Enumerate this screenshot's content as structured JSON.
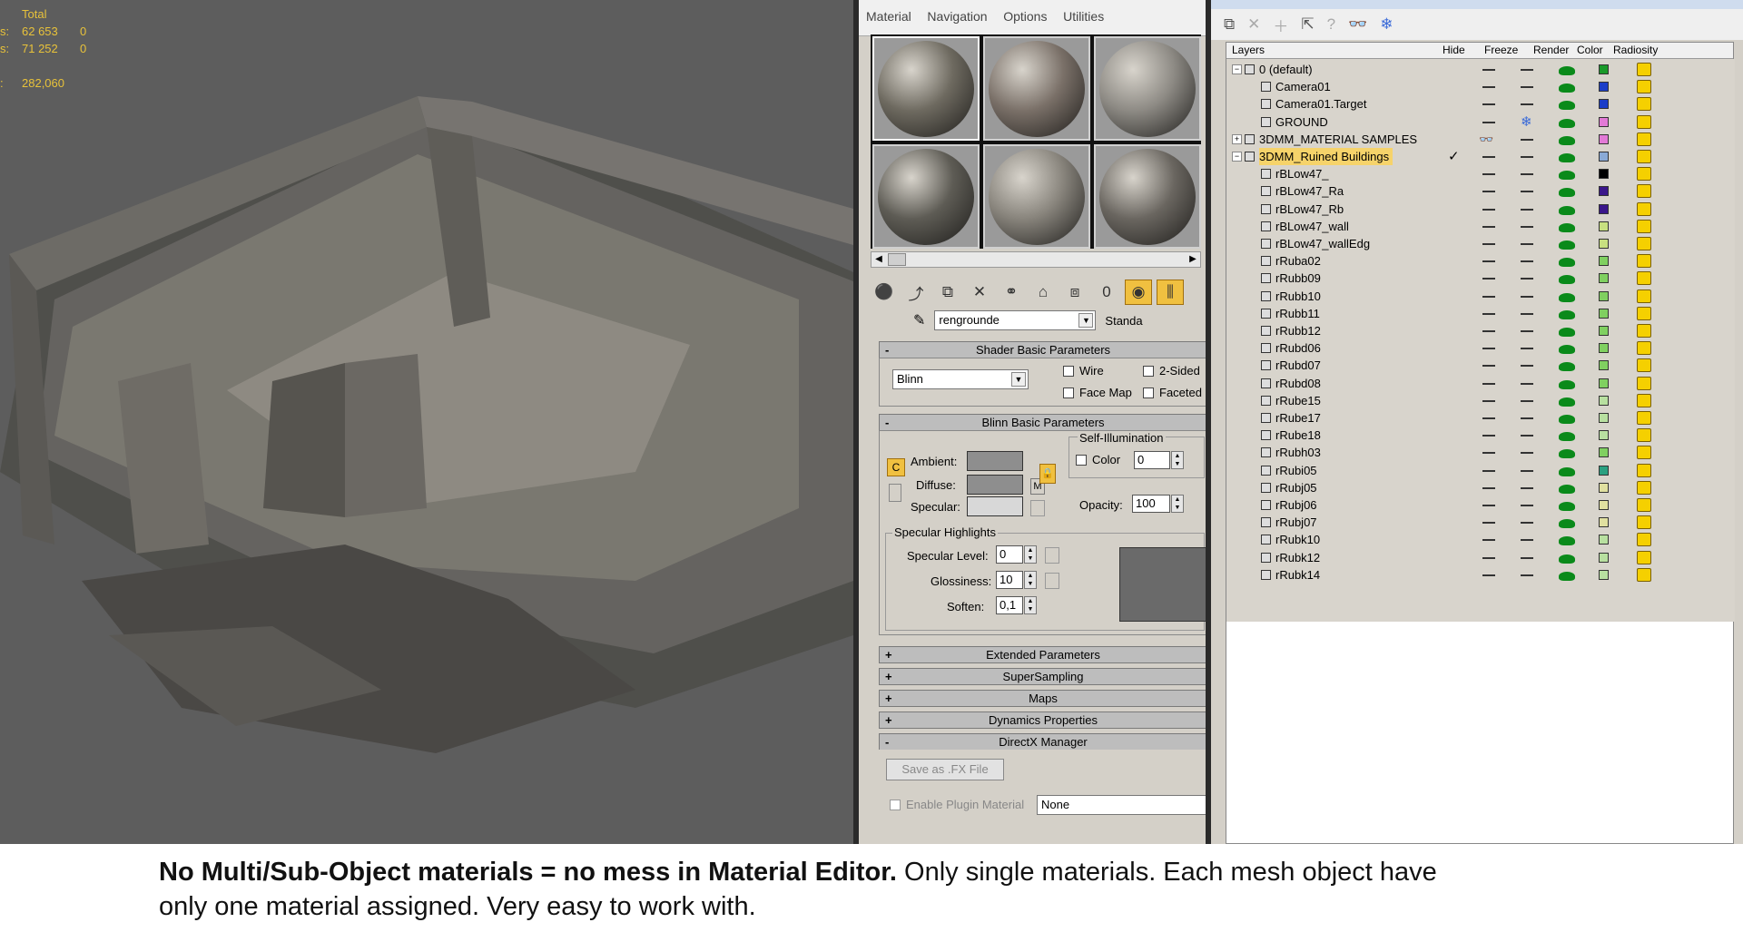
{
  "viewport": {
    "stats": {
      "header": "Total",
      "rows": [
        {
          "label": "s:",
          "value": "62 653",
          "sel": "0"
        },
        {
          "label": "s:",
          "value": "71 252",
          "sel": "0"
        },
        {
          "label": ":",
          "value": "282,060",
          "sel": ""
        }
      ]
    }
  },
  "material_editor": {
    "menu": [
      "Material",
      "Navigation",
      "Options",
      "Utilities"
    ],
    "spheres": [
      {
        "color": "#6e6a60"
      },
      {
        "color": "#7a7068"
      },
      {
        "color": "#8d8a84"
      },
      {
        "color": "#5e5c55"
      },
      {
        "color": "#88847c"
      },
      {
        "color": "#6a6660"
      }
    ],
    "material_name": "rengrounde",
    "material_type": "Standa",
    "rollouts": {
      "shader": "Shader Basic Parameters",
      "blinn": "Blinn Basic Parameters",
      "extended": "Extended Parameters",
      "supersampling": "SuperSampling",
      "maps": "Maps",
      "dynamics": "Dynamics Properties",
      "directx": "DirectX Manager"
    },
    "shader_type": "Blinn",
    "checks": {
      "wire": "Wire",
      "two_sided": "2-Sided",
      "face_map": "Face Map",
      "faceted": "Faceted"
    },
    "ambient": "Ambient:",
    "diffuse": "Diffuse:",
    "specular": "Specular:",
    "map_button": "M",
    "self_illum": "Self-Illumination",
    "self_illum_color": "Color",
    "self_illum_value": "0",
    "opacity_label": "Opacity:",
    "opacity_value": "100",
    "spec_highlights": "Specular Highlights",
    "spec_level_label": "Specular Level:",
    "spec_level": "0",
    "glossiness_label": "Glossiness:",
    "glossiness": "10",
    "soften_label": "Soften:",
    "soften": "0,1",
    "save_fx": "Save as .FX File",
    "enable_plugin": "Enable Plugin Material",
    "plugin_value": "None"
  },
  "layer_manager": {
    "columns": [
      "Layers",
      "Hide",
      "Freeze",
      "Render",
      "Color",
      "Radiosity"
    ],
    "rows": [
      {
        "name": "0 (default)",
        "level": 0,
        "layer": true,
        "expander": "−",
        "color": "#1a9a2a",
        "hide": "—",
        "freeze": "—",
        "current": false
      },
      {
        "name": "Camera01",
        "level": 1,
        "layer": false,
        "color": "#1c3ec8",
        "hide": "—",
        "freeze": "—",
        "current": false
      },
      {
        "name": "Camera01.Target",
        "level": 1,
        "layer": false,
        "color": "#1c3ec8",
        "hide": "—",
        "freeze": "—",
        "current": false
      },
      {
        "name": "GROUND",
        "level": 1,
        "layer": false,
        "color": "#e27ad6",
        "hide": "—",
        "freeze": "❄",
        "current": false
      },
      {
        "name": "3DMM_MATERIAL SAMPLES",
        "level": 0,
        "layer": true,
        "expander": "+",
        "color": "#e27ad6",
        "hide": "👓",
        "freeze": "—",
        "current": false
      },
      {
        "name": "3DMM_Ruined Buildings",
        "level": 0,
        "layer": true,
        "expander": "−",
        "color": "#8aaad6",
        "hide": "—",
        "freeze": "—",
        "current": true,
        "check": "✓"
      },
      {
        "name": "rBLow47_",
        "level": 1,
        "layer": false,
        "color": "#000000",
        "hide": "—",
        "freeze": "—",
        "current": false
      },
      {
        "name": "rBLow47_Ra",
        "level": 1,
        "layer": false,
        "color": "#3a168a",
        "hide": "—",
        "freeze": "—",
        "current": false
      },
      {
        "name": "rBLow47_Rb",
        "level": 1,
        "layer": false,
        "color": "#3a168a",
        "hide": "—",
        "freeze": "—",
        "current": false
      },
      {
        "name": "rBLow47_wall",
        "level": 1,
        "layer": false,
        "color": "#c8e080",
        "hide": "—",
        "freeze": "—",
        "current": false
      },
      {
        "name": "rBLow47_wallEdg",
        "level": 1,
        "layer": false,
        "color": "#c8e080",
        "hide": "—",
        "freeze": "—",
        "current": false
      },
      {
        "name": "rRuba02",
        "level": 1,
        "layer": false,
        "color": "#80d060",
        "hide": "—",
        "freeze": "—",
        "current": false
      },
      {
        "name": "rRubb09",
        "level": 1,
        "layer": false,
        "color": "#80d060",
        "hide": "—",
        "freeze": "—",
        "current": false
      },
      {
        "name": "rRubb10",
        "level": 1,
        "layer": false,
        "color": "#80d060",
        "hide": "—",
        "freeze": "—",
        "current": false
      },
      {
        "name": "rRubb11",
        "level": 1,
        "layer": false,
        "color": "#80d060",
        "hide": "—",
        "freeze": "—",
        "current": false
      },
      {
        "name": "rRubb12",
        "level": 1,
        "layer": false,
        "color": "#80d060",
        "hide": "—",
        "freeze": "—",
        "current": false
      },
      {
        "name": "rRubd06",
        "level": 1,
        "layer": false,
        "color": "#80d060",
        "hide": "—",
        "freeze": "—",
        "current": false
      },
      {
        "name": "rRubd07",
        "level": 1,
        "layer": false,
        "color": "#80d060",
        "hide": "—",
        "freeze": "—",
        "current": false
      },
      {
        "name": "rRubd08",
        "level": 1,
        "layer": false,
        "color": "#80d060",
        "hide": "—",
        "freeze": "—",
        "current": false
      },
      {
        "name": "rRube15",
        "level": 1,
        "layer": false,
        "color": "#b8e0a0",
        "hide": "—",
        "freeze": "—",
        "current": false
      },
      {
        "name": "rRube17",
        "level": 1,
        "layer": false,
        "color": "#b8e0a0",
        "hide": "—",
        "freeze": "—",
        "current": false
      },
      {
        "name": "rRube18",
        "level": 1,
        "layer": false,
        "color": "#b8e0a0",
        "hide": "—",
        "freeze": "—",
        "current": false
      },
      {
        "name": "rRubh03",
        "level": 1,
        "layer": false,
        "color": "#80d060",
        "hide": "—",
        "freeze": "—",
        "current": false
      },
      {
        "name": "rRubi05",
        "level": 1,
        "layer": false,
        "color": "#2aa080",
        "hide": "—",
        "freeze": "—",
        "current": false
      },
      {
        "name": "rRubj05",
        "level": 1,
        "layer": false,
        "color": "#e0e0a0",
        "hide": "—",
        "freeze": "—",
        "current": false
      },
      {
        "name": "rRubj06",
        "level": 1,
        "layer": false,
        "color": "#e0e0a0",
        "hide": "—",
        "freeze": "—",
        "current": false
      },
      {
        "name": "rRubj07",
        "level": 1,
        "layer": false,
        "color": "#e0e0a0",
        "hide": "—",
        "freeze": "—",
        "current": false
      },
      {
        "name": "rRubk10",
        "level": 1,
        "layer": false,
        "color": "#b8e0a0",
        "hide": "—",
        "freeze": "—",
        "current": false
      },
      {
        "name": "rRubk12",
        "level": 1,
        "layer": false,
        "color": "#b8e0a0",
        "hide": "—",
        "freeze": "—",
        "current": false
      },
      {
        "name": "rRubk14",
        "level": 1,
        "layer": false,
        "color": "#b8e0a0",
        "hide": "—",
        "freeze": "—",
        "current": false
      }
    ]
  },
  "caption": {
    "bold": "No Multi/Sub-Object materials = no mess in Material Editor.",
    "line1": " Only single materials. Each mesh object have",
    "line2": "only one material assigned. Very easy to work with."
  }
}
